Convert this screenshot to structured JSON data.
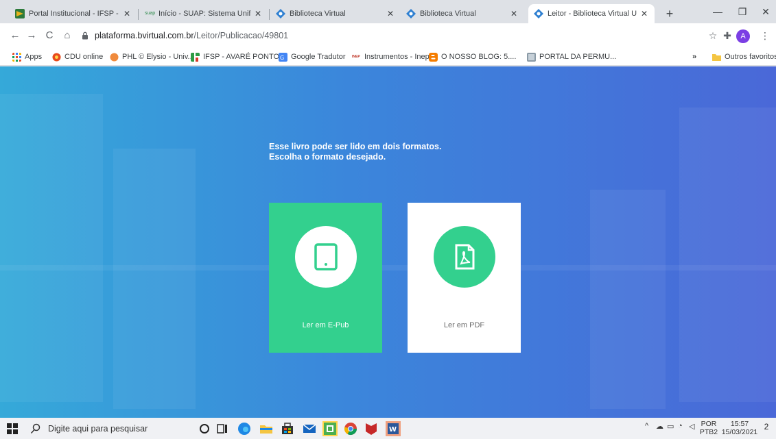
{
  "browser": {
    "tabs": [
      {
        "title": "Portal Institucional - IFSP - Bus",
        "favicon": "ifsp-favicon",
        "active": false
      },
      {
        "title": "Início - SUAP: Sistema Unificad",
        "favicon": "suap-favicon",
        "favicon_text": "suap",
        "active": false
      },
      {
        "title": "Biblioteca Virtual",
        "favicon": "bvirtual-favicon",
        "active": false
      },
      {
        "title": "Biblioteca Virtual",
        "favicon": "bvirtual-favicon",
        "active": false
      },
      {
        "title": "Leitor - Biblioteca Virtual Unive",
        "favicon": "bvirtual-favicon",
        "active": true
      }
    ],
    "new_tab": "+",
    "url_domain": "plataforma.bvirtual.com.br",
    "url_path": "/Leitor/Publicacao/49801",
    "avatar_letter": "A",
    "bookmarks": [
      {
        "label": "Apps",
        "icon": "apps-grid-icon"
      },
      {
        "label": "CDU online",
        "icon": "cdu-icon"
      },
      {
        "label": "PHL © Elysio - Univ...",
        "icon": "phl-icon"
      },
      {
        "label": "IFSP - AVARÉ PONTO",
        "icon": "ifsp-icon"
      },
      {
        "label": "Google Tradutor",
        "icon": "translate-icon"
      },
      {
        "label": "Instrumentos - Inep",
        "icon": "inep-icon",
        "icon_text": "INEP"
      },
      {
        "label": "O NOSSO BLOG: 5....",
        "icon": "blogger-icon"
      },
      {
        "label": "PORTAL DA PERMU...",
        "icon": "portal-icon"
      }
    ],
    "bookmarks_overflow": "»",
    "other_favorites": "Outros favoritos"
  },
  "page": {
    "heading_line1": "Esse livro pode ser lido em dois formatos.",
    "heading_line2": "Escolha o formato desejado.",
    "options": [
      {
        "label": "Ler em E-Pub",
        "icon": "tablet-icon"
      },
      {
        "label": "Ler em PDF",
        "icon": "pdf-file-icon"
      }
    ]
  },
  "colors": {
    "epub_card": "#33d08e",
    "pdf_card": "#ffffff",
    "background_start": "#35a9d9",
    "background_end": "#4a68d8"
  },
  "taskbar": {
    "search_placeholder": "Digite aqui para pesquisar",
    "lang_line1": "POR",
    "lang_line2": "PTB2",
    "time": "15:57",
    "date": "15/03/2021",
    "notification_count": "2"
  }
}
